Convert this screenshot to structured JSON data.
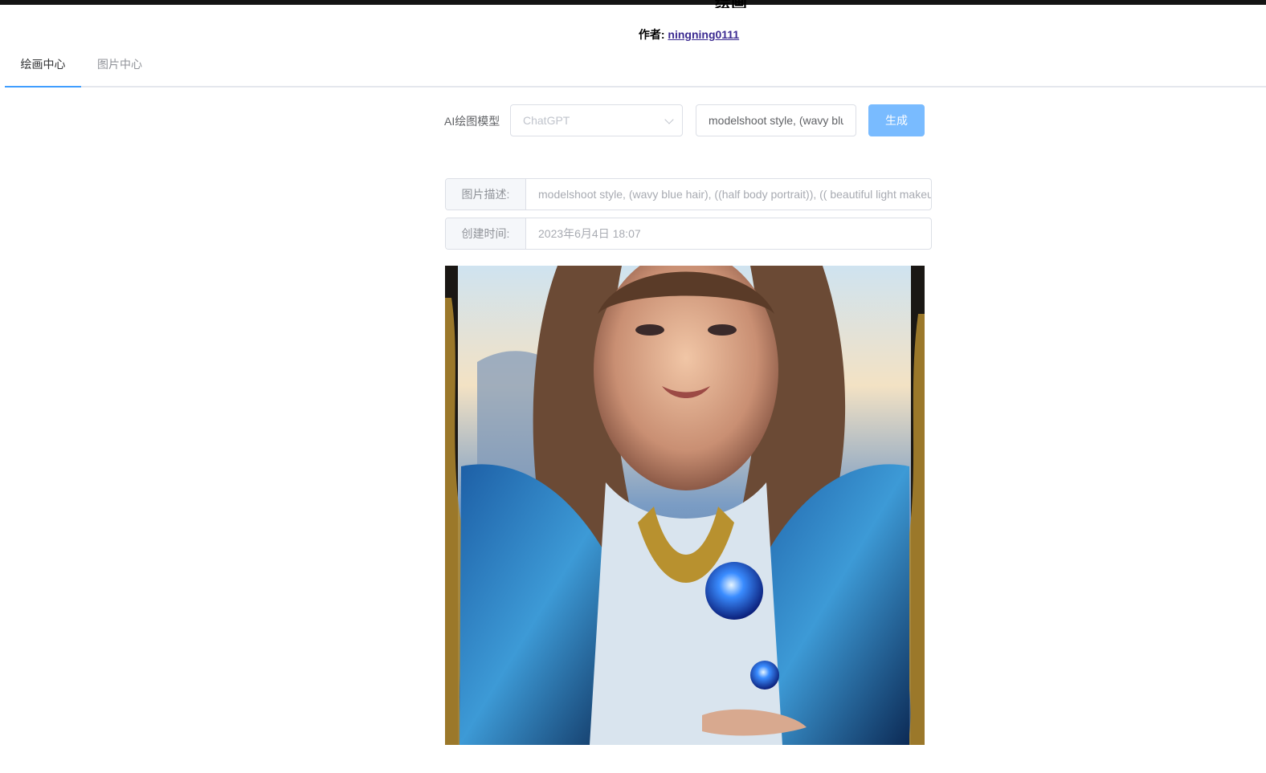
{
  "header": {
    "title_fragment": "绘画",
    "author_label": "作者:",
    "author_name": "ningning0111"
  },
  "tabs": [
    {
      "label": "绘画中心",
      "active": true
    },
    {
      "label": "图片中心",
      "active": false
    }
  ],
  "toolbar": {
    "model_label": "AI绘图模型",
    "model_selected": "ChatGPT",
    "prompt_value": "modelshoot style, (wavy blue hair), ((half body portrait)), (( beautiful light makeup",
    "generate_label": "生成"
  },
  "details": {
    "description_label": "图片描述:",
    "description_value": "modelshoot style, (wavy blue hair), ((half body portrait)), (( beautiful light makeup",
    "created_label": "创建时间:",
    "created_value": "2023年6月4日 18:07"
  },
  "colors": {
    "accent": "#409eff",
    "button": "#79bbff",
    "top_bar": "#141414"
  },
  "icons": {
    "select_arrow": "chevron-down-icon"
  }
}
